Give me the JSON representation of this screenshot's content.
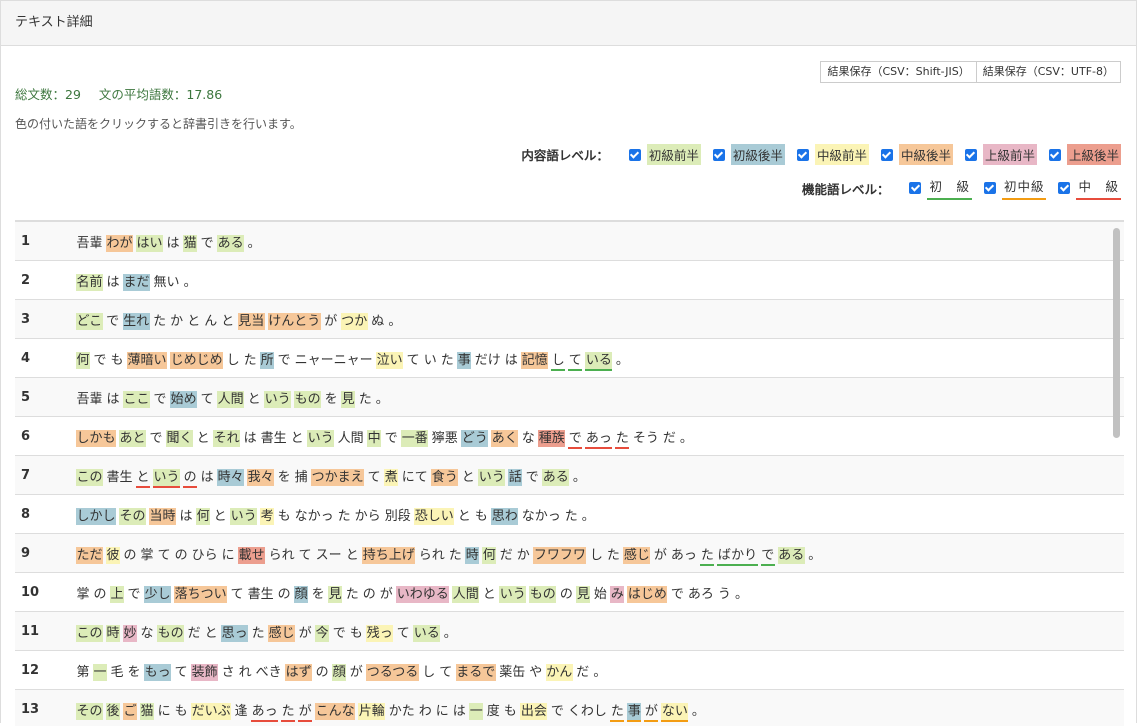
{
  "header": {
    "title": "テキスト詳細"
  },
  "save_buttons": [
    "結果保存（CSV：Shift-JIS）",
    "結果保存（CSV：UTF-8）"
  ],
  "stats": {
    "sentences": "総文数：29",
    "avg_words": "文の平均語数：17.86"
  },
  "hint": "色の付いた語をクリックすると辞書引きを行います。",
  "content_levels": {
    "title": "内容語レベル：",
    "items": [
      {
        "label": "初級前半",
        "color": "#dcecb8",
        "checked": true
      },
      {
        "label": "初級後半",
        "color": "#a9cbd6",
        "checked": true
      },
      {
        "label": "中級前半",
        "color": "#fbf4b6",
        "checked": true
      },
      {
        "label": "中級後半",
        "color": "#f6c799",
        "checked": true
      },
      {
        "label": "上級前半",
        "color": "#e8b7c6",
        "checked": true
      },
      {
        "label": "上級後半",
        "color": "#ec9e8e",
        "checked": true
      }
    ]
  },
  "function_levels": {
    "title": "機能語レベル：",
    "items": [
      {
        "label": "初　級",
        "color": "#4caf50",
        "checked": true
      },
      {
        "label": "初中級",
        "color": "#f39c12",
        "checked": true
      },
      {
        "label": "中　級",
        "color": "#e74c3c",
        "checked": true
      }
    ]
  },
  "rows": [
    {
      "n": "1",
      "tokens": [
        [
          "吾輩",
          ""
        ],
        [
          "わが",
          "c4"
        ],
        [
          "はい",
          "c1"
        ],
        [
          "は",
          ""
        ],
        [
          "猫",
          "c1"
        ],
        [
          "で",
          ""
        ],
        [
          "ある",
          "c1"
        ],
        [
          "。",
          ""
        ]
      ]
    },
    {
      "n": "2",
      "tokens": [
        [
          "名前",
          "c1"
        ],
        [
          "は",
          ""
        ],
        [
          "まだ",
          "c2"
        ],
        [
          "無い",
          ""
        ],
        [
          "。",
          ""
        ]
      ]
    },
    {
      "n": "3",
      "tokens": [
        [
          "どこ",
          "c1"
        ],
        [
          "で",
          ""
        ],
        [
          "生れ",
          "c2"
        ],
        [
          "た",
          ""
        ],
        [
          "か",
          ""
        ],
        [
          "と",
          ""
        ],
        [
          "ん",
          ""
        ],
        [
          "と",
          ""
        ],
        [
          "見当",
          "c4"
        ],
        [
          "けんとう",
          "c4"
        ],
        [
          "が",
          ""
        ],
        [
          "つか",
          "c3"
        ],
        [
          "ぬ",
          ""
        ],
        [
          "。",
          ""
        ]
      ]
    },
    {
      "n": "4",
      "tokens": [
        [
          "何",
          "c1"
        ],
        [
          "で",
          ""
        ],
        [
          "も",
          ""
        ],
        [
          "薄暗い",
          "c4"
        ],
        [
          "じめじめ",
          "c4"
        ],
        [
          "し",
          ""
        ],
        [
          "た",
          ""
        ],
        [
          "所",
          "c2"
        ],
        [
          "で",
          ""
        ],
        [
          "ニャーニャー",
          ""
        ],
        [
          "泣い",
          "c3"
        ],
        [
          "て",
          ""
        ],
        [
          "い",
          ""
        ],
        [
          "た",
          ""
        ],
        [
          "事",
          "c2"
        ],
        [
          "だけ",
          ""
        ],
        [
          "は",
          ""
        ],
        [
          "記憶",
          "c4"
        ],
        [
          "し",
          "u1"
        ],
        [
          "て",
          "u1"
        ],
        [
          "いる",
          "c1 u1"
        ],
        [
          "。",
          ""
        ]
      ]
    },
    {
      "n": "5",
      "tokens": [
        [
          "吾輩",
          ""
        ],
        [
          "は",
          ""
        ],
        [
          "ここ",
          "c1"
        ],
        [
          "で",
          ""
        ],
        [
          "始め",
          "c2"
        ],
        [
          "て",
          ""
        ],
        [
          "人間",
          "c1"
        ],
        [
          "と",
          ""
        ],
        [
          "いう",
          "c1"
        ],
        [
          "もの",
          "c1"
        ],
        [
          "を",
          ""
        ],
        [
          "見",
          "c1"
        ],
        [
          "た",
          ""
        ],
        [
          "。",
          ""
        ]
      ]
    },
    {
      "n": "6",
      "tokens": [
        [
          "しかも",
          "c4"
        ],
        [
          "あと",
          "c1"
        ],
        [
          "で",
          ""
        ],
        [
          "聞く",
          "c1"
        ],
        [
          "と",
          ""
        ],
        [
          "それ",
          "c1"
        ],
        [
          "は",
          ""
        ],
        [
          "書生",
          ""
        ],
        [
          "と",
          ""
        ],
        [
          "いう",
          "c1"
        ],
        [
          "人間",
          ""
        ],
        [
          "中",
          "c1"
        ],
        [
          "で",
          ""
        ],
        [
          "一番",
          "c1"
        ],
        [
          "獰悪",
          ""
        ],
        [
          "どう",
          "c2"
        ],
        [
          "あく",
          "c4"
        ],
        [
          "な",
          ""
        ],
        [
          "種族",
          "c6"
        ],
        [
          "で",
          "u3"
        ],
        [
          "あっ",
          "u3"
        ],
        [
          "た",
          "u3"
        ],
        [
          "そう",
          ""
        ],
        [
          "だ",
          ""
        ],
        [
          "。",
          ""
        ]
      ]
    },
    {
      "n": "7",
      "tokens": [
        [
          "この",
          "c1"
        ],
        [
          "書生",
          ""
        ],
        [
          "と",
          "u3"
        ],
        [
          "いう",
          "c1 u3"
        ],
        [
          "の",
          "u3"
        ],
        [
          "は",
          ""
        ],
        [
          "時々",
          "c2"
        ],
        [
          "我々",
          "c4"
        ],
        [
          "を",
          ""
        ],
        [
          "捕",
          ""
        ],
        [
          "つかまえ",
          "c4"
        ],
        [
          "て",
          ""
        ],
        [
          "煮",
          "c3"
        ],
        [
          "にて",
          ""
        ],
        [
          "食う",
          "c4"
        ],
        [
          "と",
          ""
        ],
        [
          "いう",
          "c1"
        ],
        [
          "話",
          "c2"
        ],
        [
          "で",
          ""
        ],
        [
          "ある",
          "c1"
        ],
        [
          "。",
          ""
        ]
      ]
    },
    {
      "n": "8",
      "tokens": [
        [
          "しかし",
          "c2"
        ],
        [
          "その",
          "c1"
        ],
        [
          "当時",
          "c4"
        ],
        [
          "は",
          ""
        ],
        [
          "何",
          "c1"
        ],
        [
          "と",
          ""
        ],
        [
          "いう",
          "c1"
        ],
        [
          "考",
          "c3"
        ],
        [
          "も",
          ""
        ],
        [
          "なかっ",
          ""
        ],
        [
          "た",
          ""
        ],
        [
          "から",
          ""
        ],
        [
          "別段",
          ""
        ],
        [
          "恐しい",
          "c3"
        ],
        [
          "と",
          ""
        ],
        [
          "も",
          ""
        ],
        [
          "思わ",
          "c2"
        ],
        [
          "なかっ",
          ""
        ],
        [
          "た",
          ""
        ],
        [
          "。",
          ""
        ]
      ]
    },
    {
      "n": "9",
      "tokens": [
        [
          "ただ",
          "c4"
        ],
        [
          "彼",
          "c3"
        ],
        [
          "の",
          ""
        ],
        [
          "掌",
          ""
        ],
        [
          "て",
          ""
        ],
        [
          "の",
          ""
        ],
        [
          "ひら",
          ""
        ],
        [
          "に",
          ""
        ],
        [
          "載せ",
          "c6"
        ],
        [
          "られ",
          ""
        ],
        [
          "て",
          ""
        ],
        [
          "スー",
          ""
        ],
        [
          "と",
          ""
        ],
        [
          "持ち上げ",
          "c4"
        ],
        [
          "られ",
          ""
        ],
        [
          "た",
          ""
        ],
        [
          "時",
          "c2"
        ],
        [
          "何",
          "c1"
        ],
        [
          "だ",
          ""
        ],
        [
          "か",
          ""
        ],
        [
          "フワフワ",
          "c4"
        ],
        [
          "し",
          ""
        ],
        [
          "た",
          ""
        ],
        [
          "感じ",
          "c4"
        ],
        [
          "が",
          ""
        ],
        [
          "あっ",
          ""
        ],
        [
          "た",
          "u1"
        ],
        [
          "ばかり",
          "u1"
        ],
        [
          "で",
          "u1"
        ],
        [
          "ある",
          "c1"
        ],
        [
          "。",
          ""
        ]
      ]
    },
    {
      "n": "10",
      "tokens": [
        [
          "掌",
          ""
        ],
        [
          "の",
          ""
        ],
        [
          "上",
          "c1"
        ],
        [
          "で",
          ""
        ],
        [
          "少し",
          "c2"
        ],
        [
          "落ちつい",
          "c4"
        ],
        [
          "て",
          ""
        ],
        [
          "書生",
          ""
        ],
        [
          "の",
          ""
        ],
        [
          "顔",
          "c2"
        ],
        [
          "を",
          ""
        ],
        [
          "見",
          "c1"
        ],
        [
          "た",
          ""
        ],
        [
          "の",
          ""
        ],
        [
          "が",
          ""
        ],
        [
          "いわゆる",
          "c5"
        ],
        [
          "人間",
          "c1"
        ],
        [
          "と",
          ""
        ],
        [
          "いう",
          "c1"
        ],
        [
          "もの",
          "c1"
        ],
        [
          "の",
          ""
        ],
        [
          "見",
          "c1"
        ],
        [
          "始",
          ""
        ],
        [
          "み",
          "c5"
        ],
        [
          "はじめ",
          "c4"
        ],
        [
          "で",
          ""
        ],
        [
          "あろ",
          ""
        ],
        [
          "う",
          ""
        ],
        [
          "。",
          ""
        ]
      ]
    },
    {
      "n": "11",
      "tokens": [
        [
          "この",
          "c1"
        ],
        [
          "時",
          "c1"
        ],
        [
          "妙",
          "c5"
        ],
        [
          "な",
          ""
        ],
        [
          "もの",
          "c1"
        ],
        [
          "だ",
          ""
        ],
        [
          "と",
          ""
        ],
        [
          "思っ",
          "c2"
        ],
        [
          "た",
          ""
        ],
        [
          "感じ",
          "c4"
        ],
        [
          "が",
          ""
        ],
        [
          "今",
          "c1"
        ],
        [
          "で",
          ""
        ],
        [
          "も",
          ""
        ],
        [
          "残っ",
          "c3"
        ],
        [
          "て",
          ""
        ],
        [
          "いる",
          "c1"
        ],
        [
          "。",
          ""
        ]
      ]
    },
    {
      "n": "12",
      "tokens": [
        [
          "第",
          ""
        ],
        [
          "一",
          "c1"
        ],
        [
          "毛",
          ""
        ],
        [
          "を",
          ""
        ],
        [
          "もっ",
          "c2"
        ],
        [
          "て",
          ""
        ],
        [
          "装飾",
          "c5"
        ],
        [
          "さ",
          ""
        ],
        [
          "れ",
          ""
        ],
        [
          "べき",
          ""
        ],
        [
          "はず",
          "c4"
        ],
        [
          "の",
          ""
        ],
        [
          "顔",
          "c1"
        ],
        [
          "が",
          ""
        ],
        [
          "つるつる",
          "c4"
        ],
        [
          "し",
          ""
        ],
        [
          "て",
          ""
        ],
        [
          "まるで",
          "c4"
        ],
        [
          "薬缶",
          ""
        ],
        [
          "や",
          ""
        ],
        [
          "かん",
          "c3"
        ],
        [
          "だ",
          ""
        ],
        [
          "。",
          ""
        ]
      ]
    },
    {
      "n": "13",
      "tokens": [
        [
          "その",
          "c1"
        ],
        [
          "後",
          "c1"
        ],
        [
          "ご",
          "c4"
        ],
        [
          "猫",
          "c1"
        ],
        [
          "に",
          ""
        ],
        [
          "も",
          ""
        ],
        [
          "だいぶ",
          "c3"
        ],
        [
          "逢",
          ""
        ],
        [
          "あっ",
          "u3"
        ],
        [
          "た",
          "u3"
        ],
        [
          "が",
          "u3"
        ],
        [
          "こんな",
          "c4"
        ],
        [
          "片輪",
          "c3"
        ],
        [
          "かた",
          ""
        ],
        [
          "わ",
          ""
        ],
        [
          "に",
          ""
        ],
        [
          "は",
          ""
        ],
        [
          "一",
          "c1"
        ],
        [
          "度",
          ""
        ],
        [
          "も",
          ""
        ],
        [
          "出会",
          "c3"
        ],
        [
          "で",
          ""
        ],
        [
          "くわし",
          ""
        ],
        [
          "た",
          "u2"
        ],
        [
          "事",
          "c2 u2"
        ],
        [
          "が",
          "u2"
        ],
        [
          "ない",
          "c3 u2"
        ],
        [
          "。",
          ""
        ]
      ]
    }
  ]
}
